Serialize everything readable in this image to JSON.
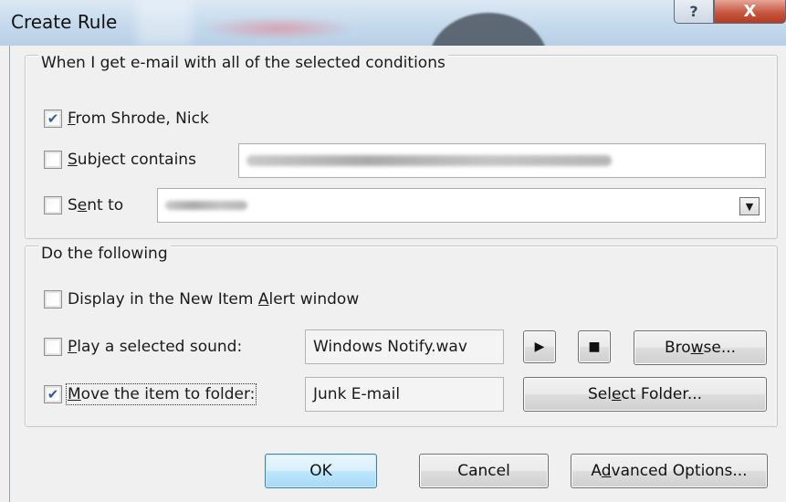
{
  "window": {
    "title": "Create Rule",
    "help_glyph": "?",
    "close_glyph": "X"
  },
  "conditions": {
    "group_label": "When I get e-mail with all of the selected conditions",
    "from": {
      "checked": true,
      "prefix": "F",
      "rest": "rom Shrode, Nick"
    },
    "subject": {
      "checked": false,
      "prefix": "S",
      "rest": "ubject contains"
    },
    "sent_to": {
      "checked": false,
      "pre": "S",
      "u": "e",
      "rest": "nt to",
      "dropdown_icon": "chevron-down-icon"
    }
  },
  "actions": {
    "group_label": "Do the following",
    "display_alert": {
      "checked": false,
      "pre": "Display in the New Item ",
      "u": "A",
      "rest": "lert window"
    },
    "play_sound": {
      "checked": false,
      "prefix": "P",
      "rest": "lay a selected sound:",
      "value": "Windows Notify.wav"
    },
    "play_button_glyph": "▶",
    "stop_button_glyph": "■",
    "browse": {
      "pre": "Bro",
      "u": "w",
      "rest": "se..."
    },
    "move_folder": {
      "checked": true,
      "prefix": "M",
      "rest": "ove the item to folder:",
      "value": "Junk E-mail"
    },
    "select_folder": {
      "pre": "Sel",
      "u": "e",
      "rest": "ct Folder..."
    }
  },
  "footer": {
    "ok_label": "OK",
    "cancel_label": "Cancel",
    "advanced": {
      "pre": "A",
      "u": "d",
      "rest": "vanced Options..."
    }
  }
}
